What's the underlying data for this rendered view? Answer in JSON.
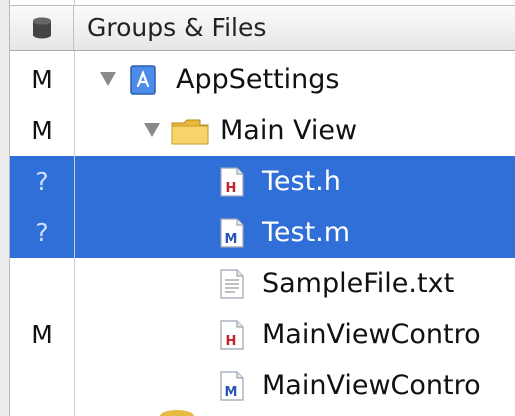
{
  "header": {
    "scm_icon": "database-icon",
    "title": "Groups & Files"
  },
  "colors": {
    "selection": "#2f6fd7",
    "folder": "#f3c94f",
    "header_file_letter": "#c3202b",
    "source_file_letter": "#2a55b8"
  },
  "rows": [
    {
      "status": "M",
      "name": "AppSettings",
      "icon": "project-icon",
      "expanded": true,
      "selected": false
    },
    {
      "status": "M",
      "name": "Main View",
      "icon": "folder-icon",
      "expanded": true,
      "selected": false
    },
    {
      "status": "?",
      "name": "Test.h",
      "icon": "header-file-icon",
      "file_letter": "H",
      "selected": true
    },
    {
      "status": "?",
      "name": "Test.m",
      "icon": "source-file-icon",
      "file_letter": "M",
      "selected": true
    },
    {
      "status": "",
      "name": "SampleFile.txt",
      "icon": "text-file-icon",
      "selected": false
    },
    {
      "status": "M",
      "name": "MainViewContro",
      "icon": "header-file-icon",
      "file_letter": "H",
      "selected": false
    },
    {
      "status": "",
      "name": "MainViewContro",
      "icon": "source-file-icon",
      "file_letter": "M",
      "selected": false
    }
  ]
}
